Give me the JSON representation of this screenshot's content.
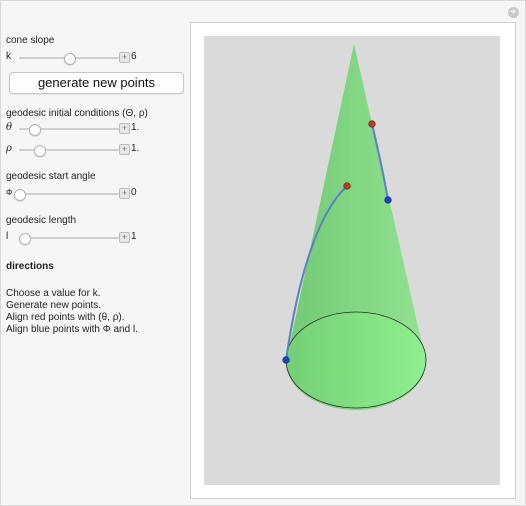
{
  "window": {
    "corner_button": "+"
  },
  "controls": {
    "cone_slope": {
      "label": "cone slope",
      "symbol": "k",
      "value": "6",
      "level": 0.5
    },
    "generate_button": "generate new points",
    "geodesic_ic": {
      "label": "geodesic initial conditions (Θ, ρ)",
      "theta": {
        "symbol": "θ",
        "value": "1.",
        "level": 0.15
      },
      "rho": {
        "symbol": "ρ",
        "value": "1.",
        "level": 0.2
      }
    },
    "start_angle": {
      "label": "geodesic start angle",
      "symbol": "Φ",
      "value": "0",
      "level": 0.0
    },
    "length": {
      "label": "geodesic length",
      "symbol": "l",
      "value": "1",
      "level": 0.05
    },
    "plus_glyph": "+"
  },
  "directions": {
    "title": "directions",
    "lines": [
      "Choose a value for k.",
      "Generate new points.",
      "Align red points with (θ, ρ).",
      "Align blue points with Φ and l."
    ]
  },
  "colors": {
    "cone_fill": "#7ed67e",
    "cone_base": "#86e086",
    "geodesic": "#5b7fc9",
    "red_point": "#c0392b",
    "blue_point": "#1f3fd6"
  }
}
